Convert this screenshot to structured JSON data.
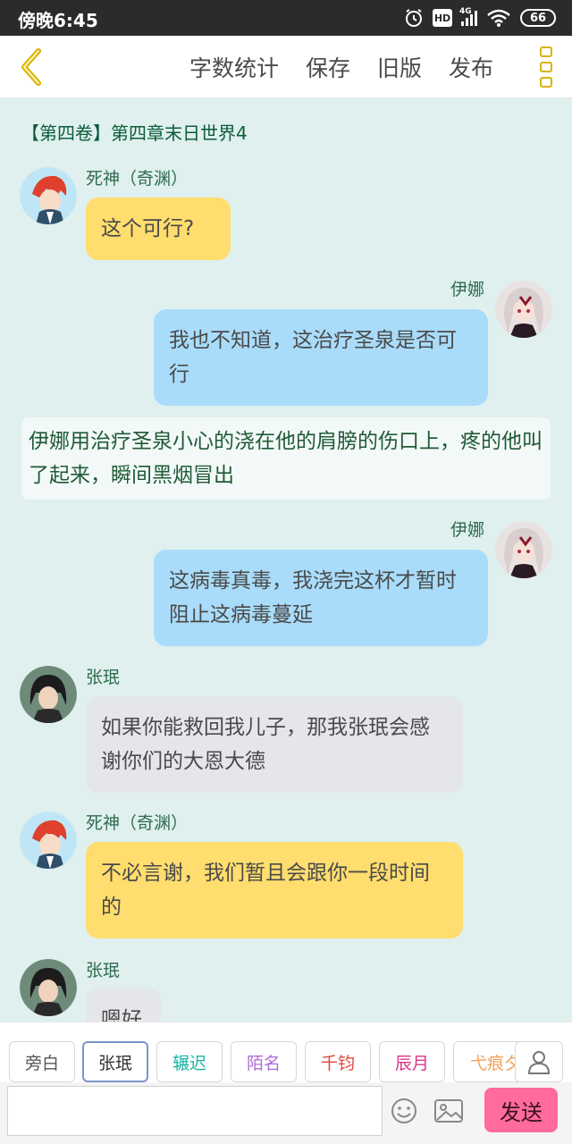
{
  "status_bar": {
    "time": "傍晚6:45",
    "network": "4G",
    "hd_label": "HD",
    "battery": "66"
  },
  "nav": {
    "back_icon": "chevron-left-icon",
    "actions": [
      "字数统计",
      "保存",
      "旧版",
      "发布"
    ],
    "more_icon": "more-vertical-icon",
    "accent_color": "#d9b300"
  },
  "chapter_title": "【第四卷】第四章末日世界4",
  "messages": [
    {
      "speaker": "死神（奇渊）",
      "text": "这个可行?",
      "side": "left",
      "color": "yellow"
    },
    {
      "speaker": "伊娜",
      "text": "我也不知道，这治疗圣泉是否可行",
      "side": "right",
      "color": "blue"
    },
    {
      "narration": "伊娜用治疗圣泉小心的浇在他的肩膀的伤口上，疼的他叫了起来，瞬间黑烟冒出"
    },
    {
      "speaker": "伊娜",
      "text": "这病毒真毒，我浇完这杯才暂时阻止这病毒蔓延",
      "side": "right",
      "color": "blue"
    },
    {
      "speaker": "张珉",
      "text": "如果你能救回我儿子，那我张珉会感谢你们的大恩大德",
      "side": "left",
      "color": "grey"
    },
    {
      "speaker": "死神（奇渊）",
      "text": "不必言谢，我们暂且会跟你一段时间的",
      "side": "left",
      "color": "yellow"
    },
    {
      "speaker": "张珉",
      "text": "嗯好",
      "side": "left",
      "color": "grey"
    }
  ],
  "roles": [
    {
      "label": "旁白",
      "color": "#555555"
    },
    {
      "label": "张珉",
      "color": "#333333",
      "selected": true
    },
    {
      "label": "辗迟",
      "color": "#19b3a6"
    },
    {
      "label": "陌名",
      "color": "#b06ad8"
    },
    {
      "label": "千钧",
      "color": "#e0473a"
    },
    {
      "label": "辰月",
      "color": "#d8378a"
    },
    {
      "label": "弋痕夕",
      "color": "#f3a25a"
    }
  ],
  "composer": {
    "placeholder": "",
    "send_label": "发送",
    "send_color": "#ff6b9a"
  },
  "colors": {
    "background": "#dff0ee",
    "bubble_yellow": "#ffdd6e",
    "bubble_blue": "#a9dcfa",
    "bubble_grey": "#e5e6ea"
  }
}
